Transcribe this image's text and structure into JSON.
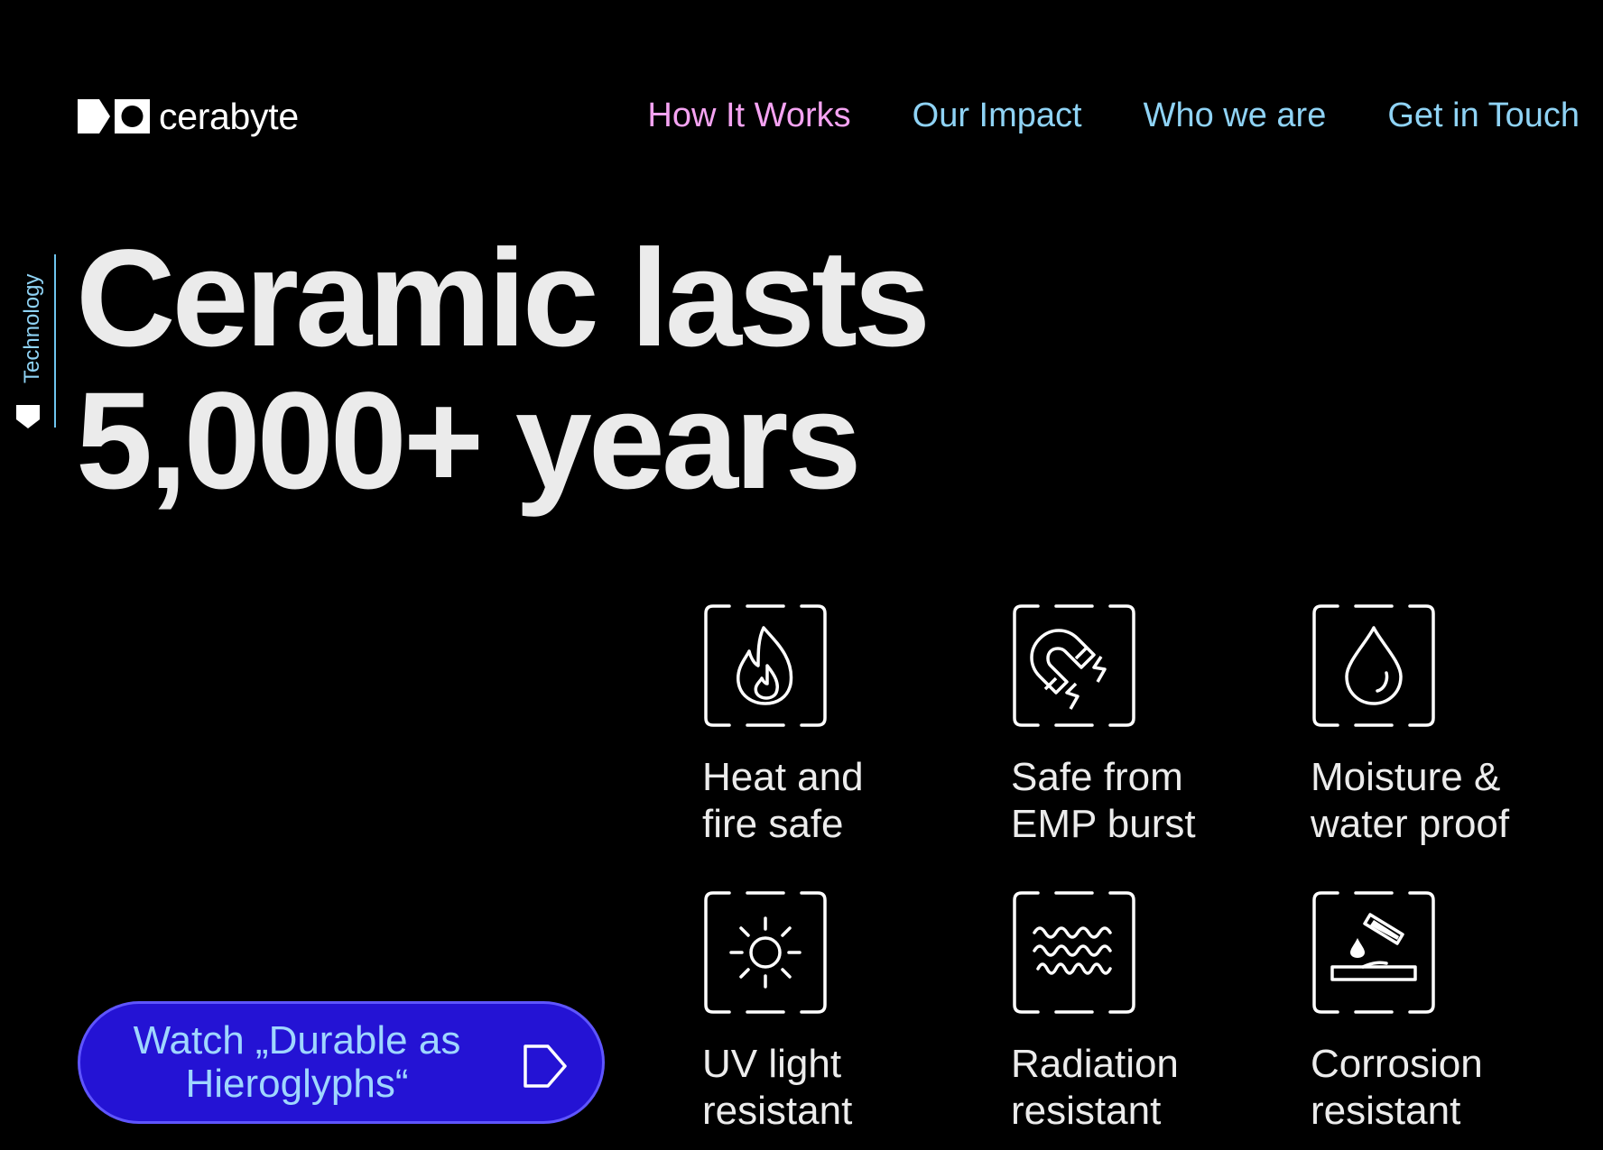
{
  "header": {
    "brand": "cerabyte",
    "nav": [
      {
        "label": "How It Works",
        "color": "#f5a3f2"
      },
      {
        "label": "Our Impact",
        "color": "#8fd3f5"
      },
      {
        "label": "Who we are",
        "color": "#8fd3f5"
      },
      {
        "label": "Get in Touch",
        "color": "#8fd3f5"
      }
    ]
  },
  "side_tab": {
    "label": "Technology",
    "icon": "pentagon-tag-icon"
  },
  "hero": {
    "title_line1": "Ceramic lasts",
    "title_line2": "5,000+ years"
  },
  "cta": {
    "label": "Watch „Durable as Hieroglyphs“",
    "icon": "play-arrow-icon"
  },
  "features": [
    {
      "label": "Heat and\nfire safe",
      "icon": "flame-icon"
    },
    {
      "label": "Safe from\nEMP burst",
      "icon": "magnet-lightning-icon"
    },
    {
      "label": "Moisture &\nwater proof",
      "icon": "water-drop-icon"
    },
    {
      "label": "UV light\nresistant",
      "icon": "sun-icon"
    },
    {
      "label": "Radiation\nresistant",
      "icon": "waves-icon"
    },
    {
      "label": "Corrosion\nresistant",
      "icon": "acid-drop-icon"
    }
  ],
  "colors": {
    "background": "#000000",
    "text": "#ececec",
    "nav_accent_pink": "#f5a3f2",
    "nav_accent_blue": "#8fd3f5",
    "button_bg": "#2413d4",
    "button_border": "#5f55ff",
    "button_text": "#9fd6ff"
  }
}
